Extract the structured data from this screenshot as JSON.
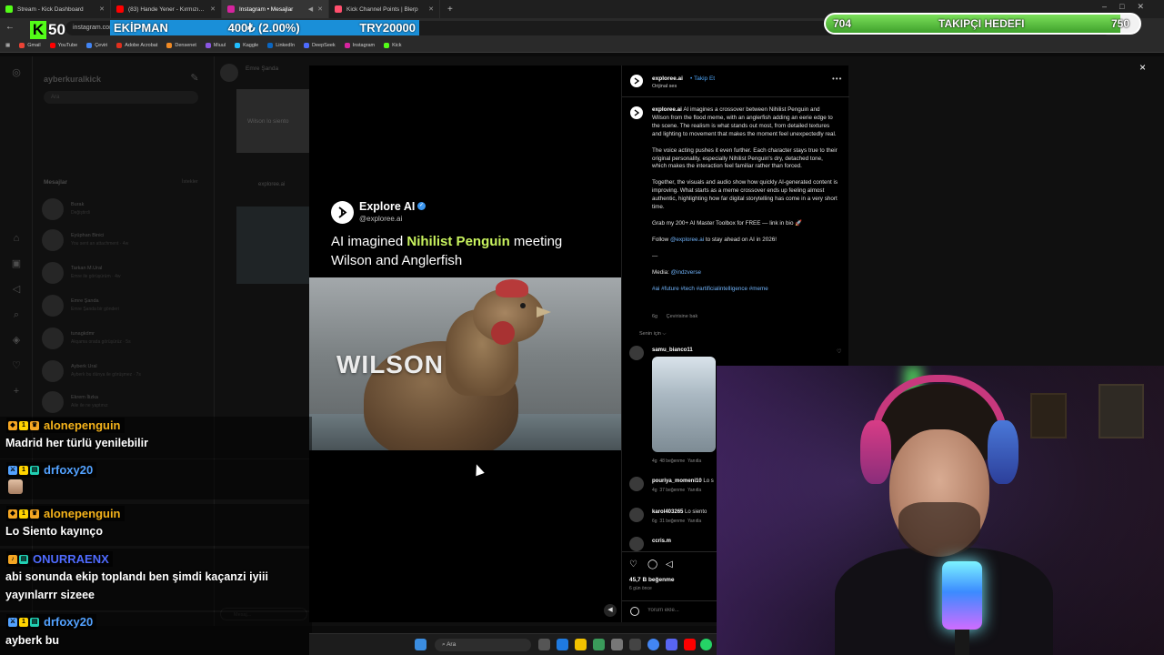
{
  "browser": {
    "tabs": [
      {
        "label": "Stream - Kick Dashboard",
        "color": "#53fc18",
        "active": false
      },
      {
        "label": "(83) Hande Yener - Kırmızı - Yo",
        "color": "#ff0000",
        "active": false
      },
      {
        "label": "Instagram • Mesajlar",
        "color": "#d6249f",
        "active": true
      },
      {
        "label": "Kick Channel Points | Blerp",
        "color": "#ff4f6d",
        "active": false
      }
    ],
    "new_tab": "+",
    "url": "instagram.com",
    "bookmarks": [
      {
        "label": "Gmail",
        "color": "#ea4335"
      },
      {
        "label": "YouTube",
        "color": "#ff0000"
      },
      {
        "label": "Çeviri",
        "color": "#4285f4"
      },
      {
        "label": "Adobe Acrobat",
        "color": "#e0301e"
      },
      {
        "label": "Densenet",
        "color": "#f08a24"
      },
      {
        "label": "Miuul",
        "color": "#8a56e2"
      },
      {
        "label": "Kaggle",
        "color": "#20beff"
      },
      {
        "label": "LinkedIn",
        "color": "#0a66c2"
      },
      {
        "label": "DeepSeek",
        "color": "#4d6bfe"
      },
      {
        "label": "Instagram",
        "color": "#d6249f"
      },
      {
        "label": "Kick",
        "color": "#53fc18"
      }
    ]
  },
  "overlay": {
    "kick_logo": "K",
    "kick_number": "50",
    "ticker_name": "EKİPMAN",
    "ticker_change": "400₺ (2.00%)",
    "ticker_value": "TRY20000",
    "goal_current": "704",
    "goal_label": "TAKIPÇI HEDEFI",
    "goal_target": "750",
    "goal_progress": 0.94
  },
  "instagram_bg": {
    "username": "ayberkuralkick",
    "search_placeholder": "Ara",
    "messages_label": "Mesajlar",
    "requests_label": "İstekler",
    "conversations": [
      {
        "name": "Burak",
        "preview": "Değiştirdi"
      },
      {
        "name": "Eyüphan Binici",
        "preview": "You sent an attachment · 4w"
      },
      {
        "name": "Tarkan M.Ural",
        "preview": "Emre ile görüşürüm · 4w"
      },
      {
        "name": "Emre Şanda",
        "preview": "Emre Şanda bir gönderi"
      },
      {
        "name": "tunagkdmr",
        "preview": "Akşama orada görüşürüz · 5s"
      },
      {
        "name": "Ayberk Ural",
        "preview": "Ayberk bu dünya ile görüşmez · 7s"
      },
      {
        "name": "Ekrem İlizka",
        "preview": "Aile ile ne yaptınız"
      }
    ],
    "chat_name": "Emre Şanda",
    "chat_thumbnail_text": "Wilson lo siento",
    "chat_shared_from": "exploree.ai",
    "chat_input_placeholder": "Mesaj..."
  },
  "post": {
    "close_icon": "×",
    "media": {
      "brand_name": "Explore AI",
      "brand_handle": "@exploree.ai",
      "headline_pre": "AI imagined ",
      "headline_accent": "Nihilist Penguin",
      "headline_post": " meeting Wilson and Anglerfish",
      "frame_caption": "WILSON",
      "accent_color": "#c8f25e"
    },
    "header": {
      "username": "exploree.ai",
      "follow": "Takip Et",
      "audio": "Orijinal ses"
    },
    "caption": {
      "username": "exploree.ai",
      "p1": "AI imagines a crossover between Nihilist Penguin and Wilson from the flood meme, with an anglerfish adding an eerie edge to the scene. The realism is what stands out most, from detailed textures and lighting to movement that makes the moment feel unexpectedly real.",
      "p2": "The voice acting pushes it even further. Each character stays true to their original personality, especially Nihilist Penguin's dry, detached tone, which makes the interaction feel familiar rather than forced.",
      "p3": "Together, the visuals and audio show how quickly AI-generated content is improving. What starts as a meme crossover ends up feeling almost authentic, highlighting how far digital storytelling has come in a very short time.",
      "p4": "Grab my 200+ AI Master Toolbox for FREE — link in bio 🚀",
      "p5_pre": "Follow ",
      "p5_link": "@exploree.ai",
      "p5_post": " to stay ahead on AI in 2026!",
      "separator": "—",
      "media_label": "Media: ",
      "media_link": "@indzverse",
      "hashtags": "#ai #future #tech #artificialintelligence #meme",
      "age": "6g",
      "translate": "Çevirisine bak"
    },
    "for_you": "Senin için ⌵",
    "comments": [
      {
        "user": "samu_bianco11",
        "text": "",
        "age": "4g",
        "likes": "48 beğenme",
        "reply": "Yanıtla"
      },
      {
        "user": "pouriya_momeni10",
        "text": "Lo s",
        "age": "4g",
        "likes": "37 beğenme",
        "reply": "Yanıtla"
      },
      {
        "user": "karol403265",
        "text": "Lo siento",
        "age": "6g",
        "likes": "31 beğenme",
        "reply": "Yanıtla"
      },
      {
        "user": "ccris.m",
        "text": "",
        "age": "",
        "likes": "",
        "reply": ""
      }
    ],
    "likes": "45,7 B beğenme",
    "date": "6 gün önce",
    "comment_placeholder": "Yorum ekle..."
  },
  "chat_overlay": [
    {
      "user": "alonepenguin",
      "color": "#f5b31b",
      "message": "Madrid her türlü yenilebilir",
      "badges": [
        "#f5a623",
        "#ffd400",
        "#f5a623"
      ]
    },
    {
      "user": "drfoxy20",
      "color": "#53a2ff",
      "message": "",
      "badges": [
        "#53a2ff",
        "#ffd400",
        "#21d0b3"
      ]
    },
    {
      "user": "alonepenguin",
      "color": "#f5b31b",
      "message": "Lo Siento kayınço",
      "badges": [
        "#f5a623",
        "#ffd400",
        "#f5a623"
      ]
    },
    {
      "user": "ONURRAENX",
      "color": "#4f6bff",
      "message": "abi sonunda ekip toplandı ben şimdi kaçanzi iyiii",
      "message2": "yayınlarrr sizeee",
      "badges": [
        "#f5a623",
        "#21d0b3"
      ]
    },
    {
      "user": "drfoxy20",
      "color": "#53a2ff",
      "message": "ayberk bu",
      "badges": [
        "#53a2ff",
        "#ffd400",
        "#21d0b3"
      ]
    }
  ],
  "taskbar": {
    "search_label": "Ara"
  }
}
